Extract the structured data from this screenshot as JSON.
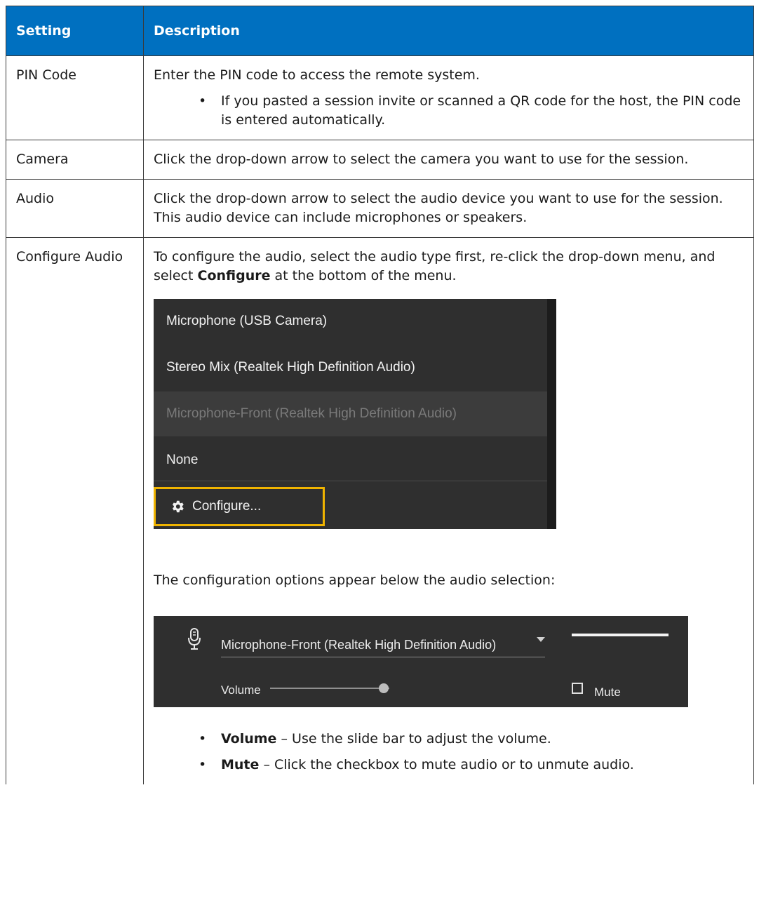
{
  "table": {
    "headers": {
      "setting": "Setting",
      "description": "Description"
    },
    "rows": [
      {
        "setting": "PIN Code",
        "text": "Enter the PIN code to access the remote system.",
        "bullet": "If you pasted a session invite or scanned a QR code for the host, the PIN code is entered automatically."
      },
      {
        "setting": "Camera",
        "text": "Click the drop-down arrow to select the camera you want to use for the session."
      },
      {
        "setting": "Audio",
        "text": "Click the drop-down arrow to select the audio device you want to use for the session. This audio device can include microphones or speakers."
      },
      {
        "setting": "Configure Audio",
        "intro_before": "To configure the audio, select the audio type first, re-click the drop-down menu, and select ",
        "intro_bold": "Configure",
        "intro_after": " at the bottom of the menu.",
        "config_note": "The configuration options appear below the audio selection:",
        "bullets": [
          {
            "bold": "Volume",
            "text": " – Use the slide bar to adjust the volume."
          },
          {
            "bold": "Mute",
            "text": " – Click the checkbox to mute audio or to unmute audio."
          }
        ]
      }
    ]
  },
  "dropdown": {
    "items": [
      "Microphone (USB Camera)",
      "Stereo Mix (Realtek High Definition Audio)",
      "Microphone-Front (Realtek High Definition Audio)",
      "None"
    ],
    "configure_label": "Configure...",
    "highlight_color": "#f0b400"
  },
  "audio_panel": {
    "device": "Microphone-Front (Realtek High Definition Audio)",
    "volume_label": "Volume",
    "volume_level": 0.95,
    "mute_label": "Mute",
    "mute_checked": false
  },
  "colors": {
    "header_bg": "#0070c0",
    "panel_bg": "#2f2f2f"
  }
}
